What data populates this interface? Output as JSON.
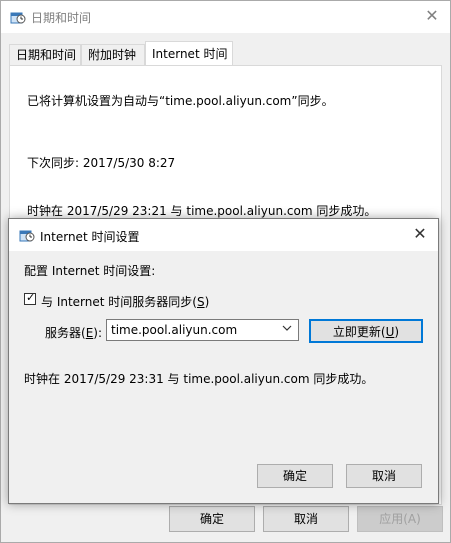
{
  "main_window": {
    "title": "日期和时间",
    "tabs": [
      "日期和时间",
      "附加时钟",
      "Internet 时间"
    ],
    "active_tab": "Internet 时间",
    "lines": {
      "configured": "已将计算机设置为自动与“time.pool.aliyun.com”同步。",
      "next_sync": "下次同步: 2017/5/30 8:27",
      "last_sync": "时钟在 2017/5/29 23:21 与 time.pool.aliyun.com 同步成功。"
    },
    "buttons": {
      "ok": "确定",
      "cancel": "取消",
      "apply": "应用(A)"
    }
  },
  "dialog": {
    "title": "Internet 时间设置",
    "configure_label": "配置 Internet 时间设置:",
    "sync_checkbox": {
      "label_pre": "与 Internet 时间服务器同步(",
      "accel": "S",
      "label_post": ")",
      "checked": true
    },
    "server_label_pre": "服务器(",
    "server_accel": "E",
    "server_label_post": "):",
    "server_value": "time.pool.aliyun.com",
    "update_button_pre": "立即更新(",
    "update_button_accel": "U",
    "update_button_post": ")",
    "status": "时钟在 2017/5/29 23:31 与 time.pool.aliyun.com 同步成功。",
    "buttons": {
      "ok": "确定",
      "cancel": "取消"
    }
  },
  "icons": {
    "window": "date-time-icon",
    "close": "close-icon",
    "dropdown": "chevron-down-icon",
    "check": "checkmark-icon"
  },
  "colors": {
    "accent_border": "#0078d7",
    "disabled_text": "#a0a0a0"
  }
}
